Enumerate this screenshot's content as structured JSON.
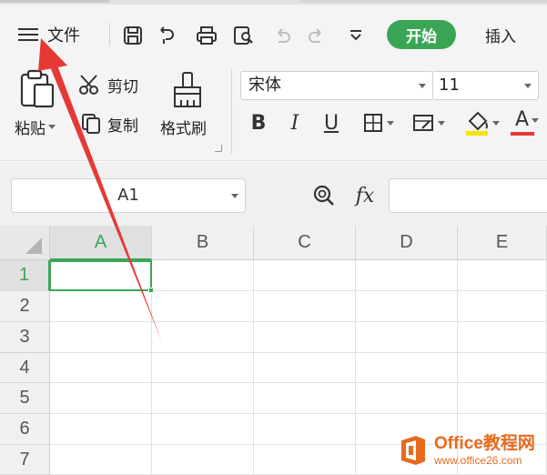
{
  "toolbar": {
    "file_menu": "文件",
    "tabs": [
      {
        "label": "开始",
        "active": true
      },
      {
        "label": "插入",
        "active": false
      }
    ]
  },
  "ribbon": {
    "paste": "粘贴",
    "cut": "剪切",
    "copy": "复制",
    "format_painter": "格式刷",
    "font_name": "宋体",
    "font_size": "11",
    "bold": "B",
    "italic": "I",
    "underline": "U",
    "font_color_glyph": "A"
  },
  "formula_bar": {
    "name_box": "A1",
    "fx": "fx",
    "formula": ""
  },
  "sheet": {
    "columns": [
      "A",
      "B",
      "C",
      "D",
      "E"
    ],
    "rows": [
      "1",
      "2",
      "3",
      "4",
      "5",
      "6",
      "7"
    ],
    "active_cell": "A1"
  },
  "watermark": {
    "main": "Office教程网",
    "sub": "www.office26.com"
  },
  "colors": {
    "accent": "#3aa655",
    "arrow": "#e53935",
    "fill_color_bar": "#f5e500",
    "font_color_bar": "#e53935"
  }
}
